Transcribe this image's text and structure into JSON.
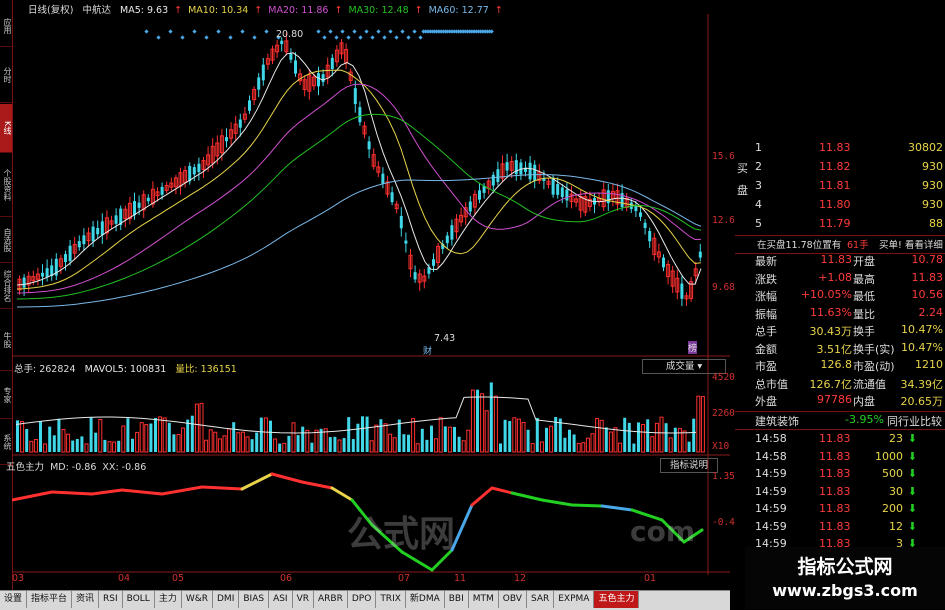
{
  "header": {
    "period": "日线(复权)",
    "stock": "中航达",
    "ma": [
      {
        "label": "MA5: 9.63",
        "color": "#e8e8e8"
      },
      {
        "label": "MA10: 10.34",
        "color": "#e8d44a"
      },
      {
        "label": "MA20: 11.86",
        "color": "#d050d0"
      },
      {
        "label": "MA30: 12.48",
        "color": "#22c022"
      },
      {
        "label": "MA60: 12.77",
        "color": "#7ab8e8"
      }
    ]
  },
  "price_axis": {
    "top": "15.61",
    "mid": "12.66",
    "low": "9.68"
  },
  "price_marks": {
    "high": "20.80",
    "low": "7.43"
  },
  "volume_header": {
    "total_label": "总手: 262824",
    "mavol_label": "MAVOL5: 100831",
    "ratio_label": "量比: 136151",
    "button": "成交量"
  },
  "volume_axis": {
    "top": "45207",
    "mid": "22604",
    "unit": "X10"
  },
  "indicator_header": {
    "name": "五色主力",
    "md_label": "MD: -0.86",
    "xx_label": "XX: -0.86",
    "button": "指标说明"
  },
  "indicator_axis": {
    "top": "1.35",
    "mid": "-0.40"
  },
  "x_axis": [
    "03",
    "04",
    "05",
    "06",
    "07",
    "11",
    "12",
    "01"
  ],
  "markers": {
    "cai": "财",
    "rong": "榜"
  },
  "left_tabs": [
    "应用",
    "分时",
    "K线",
    "个股资料",
    "自选股",
    "综合排名",
    "牛股",
    "专家",
    "系统"
  ],
  "orderbook": {
    "buy_side_label": "买盘",
    "rows": [
      {
        "level": "1",
        "price": "11.83",
        "volume": "30802"
      },
      {
        "level": "2",
        "price": "11.82",
        "volume": "930"
      },
      {
        "level": "3",
        "price": "11.81",
        "volume": "930"
      },
      {
        "level": "4",
        "price": "11.80",
        "volume": "930"
      },
      {
        "level": "5",
        "price": "11.79",
        "volume": "88"
      }
    ],
    "status_line": "在买盘11.78位置有",
    "status_count": "61手",
    "status_action": "买单! 看看详细"
  },
  "quote": [
    {
      "l1": "最新",
      "v1": "11.83",
      "l2": "开盘",
      "v2": "10.78"
    },
    {
      "l1": "涨跌",
      "v1": "+1.08",
      "l2": "最高",
      "v2": "11.83"
    },
    {
      "l1": "涨幅",
      "v1": "+10.05%",
      "l2": "最低",
      "v2": "10.56"
    },
    {
      "l1": "振幅",
      "v1": "11.63%",
      "l2": "量比",
      "v2": "2.24"
    },
    {
      "l1": "总手",
      "v1": "30.43万",
      "l2": "换手",
      "v2": "10.47%"
    },
    {
      "l1": "金额",
      "v1": "3.51亿",
      "l2": "换手(实)",
      "v2": "10.47%"
    },
    {
      "l1": "市盈",
      "v1": "126.8",
      "l2": "市盈(动)",
      "v2": "1210"
    },
    {
      "l1": "总市值",
      "v1": "126.7亿",
      "l2": "流通值",
      "v2": "34.39亿"
    },
    {
      "l1": "外盘",
      "v1": "97786",
      "l2": "内盘",
      "v2": "20.65万"
    }
  ],
  "sector": {
    "name": "建筑装饰",
    "change": "-3.95%",
    "button": "同行业比较"
  },
  "ticks": [
    {
      "time": "14:58",
      "price": "11.83",
      "volume": "23",
      "dir": "down"
    },
    {
      "time": "14:58",
      "price": "11.83",
      "volume": "1000",
      "dir": "down"
    },
    {
      "time": "14:59",
      "price": "11.83",
      "volume": "500",
      "dir": "down"
    },
    {
      "time": "14:59",
      "price": "11.83",
      "volume": "30",
      "dir": "down"
    },
    {
      "time": "14:59",
      "price": "11.83",
      "volume": "200",
      "dir": "down"
    },
    {
      "time": "14:59",
      "price": "11.83",
      "volume": "12",
      "dir": "down"
    },
    {
      "time": "14:59",
      "price": "11.83",
      "volume": "3",
      "dir": "down"
    },
    {
      "time": "14:59",
      "price": "11.83",
      "volume": "",
      "dir": ""
    }
  ],
  "bottom_tabs": [
    "设置",
    "指标平台",
    "资讯",
    "RSI",
    "BOLL",
    "主力",
    "W&R",
    "DMI",
    "BIAS",
    "ASI",
    "VR",
    "ARBR",
    "DPO",
    "TRIX",
    "新DMA",
    "BBI",
    "MTM",
    "OBV",
    "SAR",
    "EXPMA",
    "五色主力"
  ],
  "watermark": {
    "line1": "指标公式网",
    "line2": "www.zbgs3.com",
    "overlay1": "公式网",
    "overlay2": "com"
  }
}
